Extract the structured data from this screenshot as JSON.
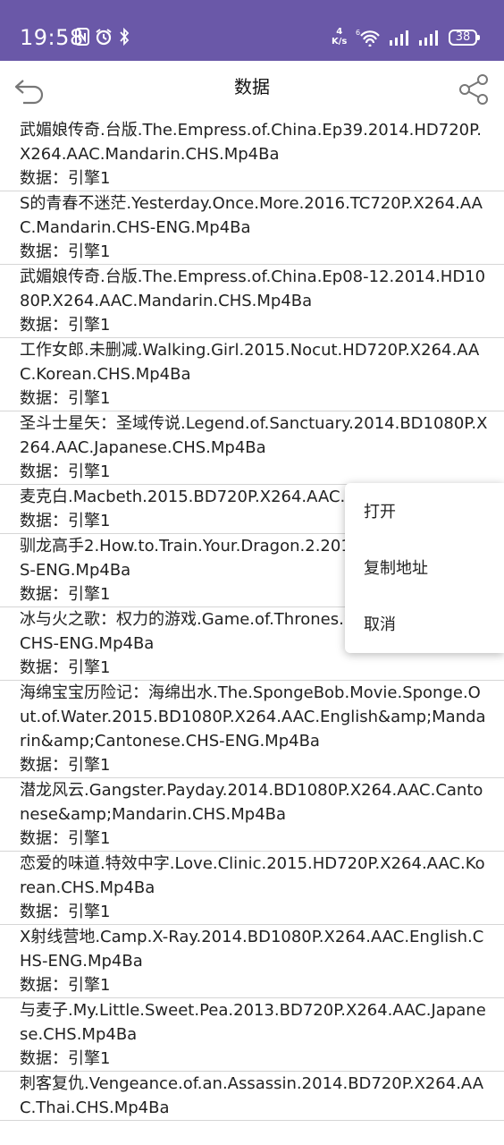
{
  "status": {
    "time": "19:58",
    "net_speed_value": "4",
    "net_speed_unit": "K/s",
    "battery": "38"
  },
  "toolbar": {
    "title": "数据",
    "back_icon": "back-icon",
    "share_icon": "share-icon"
  },
  "items": [
    {
      "name": "武媚娘传奇.台版.The.Empress.of.China.Ep39.2014.HD720P.X264.AAC.Mandarin.CHS.Mp4Ba",
      "meta": "数据：引擎1"
    },
    {
      "name": "S的青春不迷茫.Yesterday.Once.More.2016.TC720P.X264.AAC.Mandarin.CHS-ENG.Mp4Ba",
      "meta": "数据：引擎1"
    },
    {
      "name": "武媚娘传奇.台版.The.Empress.of.China.Ep08-12.2014.HD1080P.X264.AAC.Mandarin.CHS.Mp4Ba",
      "meta": "数据：引擎1"
    },
    {
      "name": "工作女郎.未删减.Walking.Girl.2015.Nocut.HD720P.X264.AAC.Korean.CHS.Mp4Ba",
      "meta": "数据：引擎1"
    },
    {
      "name": "圣斗士星矢：圣域传说.Legend.of.Sanctuary.2014.BD1080P.X264.AAC.Japanese.CHS.Mp4Ba",
      "meta": "数据：引擎1"
    },
    {
      "name": "麦克白.Macbeth.2015.BD720P.X264.AAC.English",
      "meta": "数据：引擎1"
    },
    {
      "name": "驯龙高手2.How.to.Train.Your.Dragon.2.2014.BD English.CHS-ENG.Mp4Ba",
      "meta": "数据：引擎1"
    },
    {
      "name": "冰与火之歌：权力的游戏.Game.of.Thrones.S0 4.AAC.english.CHS-ENG.Mp4Ba",
      "meta": "数据：引擎1"
    },
    {
      "name": "海绵宝宝历险记：海绵出水.The.SpongeBob.Movie.Sponge.Out.of.Water.2015.BD1080P.X264.AAC.English&amp;Mandarin&amp;Cantonese.CHS-ENG.Mp4Ba",
      "meta": "数据：引擎1"
    },
    {
      "name": "潜龙风云.Gangster.Payday.2014.BD1080P.X264.AAC.Cantonese&amp;Mandarin.CHS.Mp4Ba",
      "meta": "数据：引擎1"
    },
    {
      "name": "恋爱的味道.特效中字.Love.Clinic.2015.HD720P.X264.AAC.Korean.CHS.Mp4Ba",
      "meta": "数据：引擎1"
    },
    {
      "name": "X射线营地.Camp.X-Ray.2014.BD1080P.X264.AAC.English.CHS-ENG.Mp4Ba",
      "meta": "数据：引擎1"
    },
    {
      "name": "与麦子.My.Little.Sweet.Pea.2013.BD720P.X264.AAC.Japanese.CHS.Mp4Ba",
      "meta": "数据：引擎1"
    },
    {
      "name": "刺客复仇.Vengeance.of.an.Assassin.2014.BD720P.X264.AAC.Thai.CHS.Mp4Ba",
      "meta": ""
    }
  ],
  "menu": {
    "open": "打开",
    "copy": "复制地址",
    "cancel": "取消"
  },
  "colors": {
    "statusbar_bg": "#6a58a8",
    "divider": "#d6d6d6"
  }
}
